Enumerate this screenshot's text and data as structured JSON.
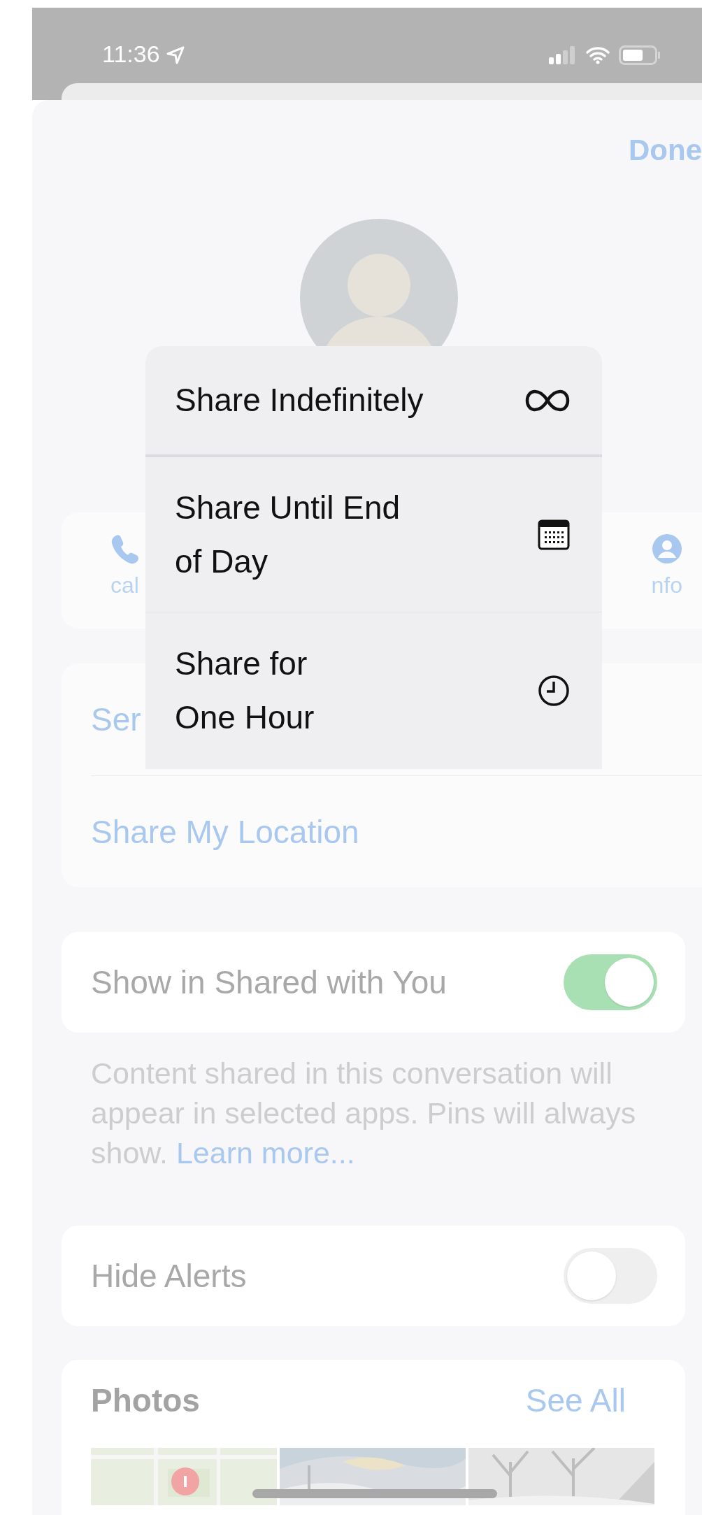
{
  "status_bar": {
    "time": "11:36"
  },
  "header": {
    "done": "Done"
  },
  "actions": [
    {
      "kind": "call",
      "label": "cal"
    },
    {
      "kind": "info",
      "label": "nfo"
    }
  ],
  "list_card": {
    "items": [
      "Ser",
      "Share My Location"
    ]
  },
  "shared_with_you": {
    "label": "Show in Shared with You",
    "on": true,
    "footer": "Content shared in this conversation will appear in selected apps. Pins will always show.",
    "link": "Learn more..."
  },
  "hide_alerts": {
    "label": "Hide Alerts",
    "on": false
  },
  "photos": {
    "title": "Photos",
    "see_all": "See All"
  },
  "menu": {
    "items": [
      {
        "kind": "infinity",
        "label": "Share Indefinitely"
      },
      {
        "kind": "calendar",
        "label": "Share Until End\nof Day"
      },
      {
        "kind": "clock",
        "label": "Share for\nOne Hour"
      }
    ]
  }
}
